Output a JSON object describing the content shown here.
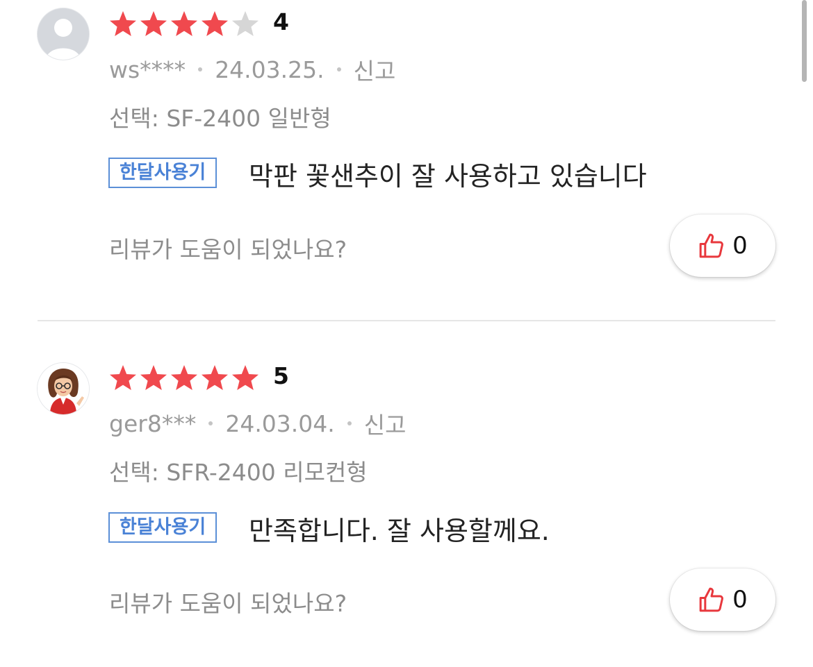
{
  "reviews": [
    {
      "rating": 4,
      "rating_label": "4",
      "user": "ws****",
      "date": "24.03.25.",
      "report_label": "신고",
      "option_text": "선택: SF-2400 일반형",
      "tag_label": "한달사용기",
      "content": "막판 꽃샌추이 잘 사용하고 있습니다",
      "helpful_question": "리뷰가 도움이 되었나요?",
      "like_count": "0",
      "avatar": "default-user-avatar"
    },
    {
      "rating": 5,
      "rating_label": "5",
      "user": "ger8***",
      "date": "24.03.04.",
      "report_label": "신고",
      "option_text": "선택: SFR-2400 리모컨형",
      "tag_label": "한달사용기",
      "content": "만족합니다. 잘 사용할께요.",
      "helpful_question": "리뷰가 도움이 되었나요?",
      "like_count": "0",
      "avatar": "woman-with-glasses-avatar"
    }
  ],
  "colors": {
    "star_filled": "#f0494e",
    "star_empty": "#d6d6d6",
    "tag_border": "#5b8fd7",
    "thumb_icon": "#e8383d"
  },
  "icons": {
    "like": "thumbs-up-icon",
    "rating": "star-icon"
  }
}
